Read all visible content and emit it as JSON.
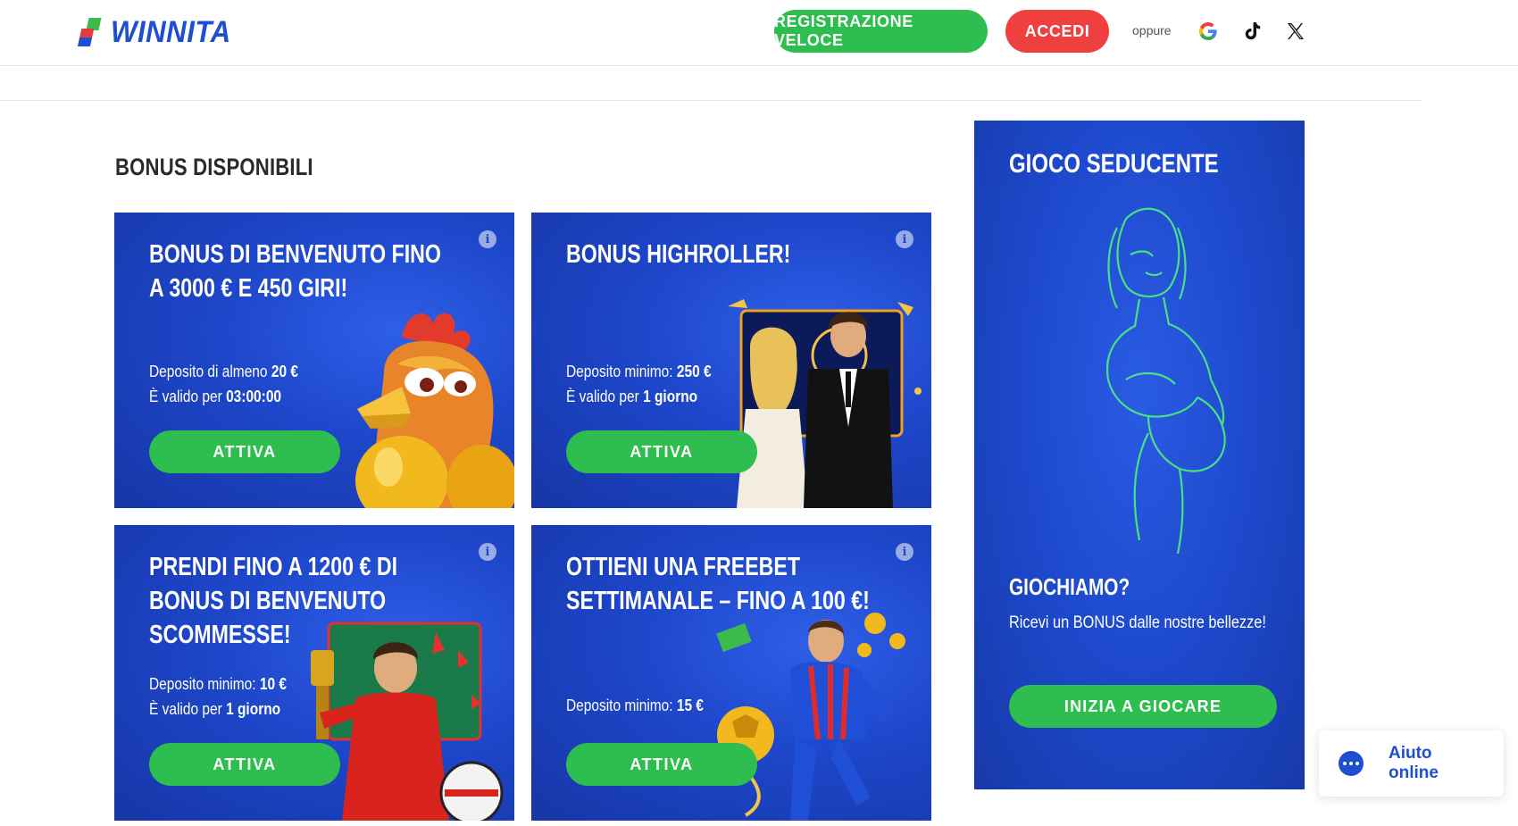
{
  "header": {
    "logo_text": "WINNITA",
    "register_label": "REGISTRAZIONE VELOCE",
    "login_label": "ACCEDI",
    "or_label": "oppure",
    "social_icons": [
      "google-icon",
      "tiktok-icon",
      "x-icon"
    ]
  },
  "colors": {
    "brand_blue": "#1e4fd1",
    "green_button": "#2ebd4f",
    "red_button": "#ef3f3f",
    "card_blue": "#1d46c9"
  },
  "bonuses": {
    "section_title": "BONUS DISPONIBILI",
    "cards": [
      {
        "title": "BONUS DI BENVENUTO FINO A 3000 € E 450 GIRI!",
        "line1_label": "Deposito di almeno",
        "line1_value": "20 €",
        "line2_label": "È valido per",
        "line2_value": "03:00:00",
        "button": "ATTIVA"
      },
      {
        "title": "BONUS HIGHROLLER!",
        "line1_label": "Deposito minimo:",
        "line1_value": "250 €",
        "line2_label": "È valido per",
        "line2_value": "1 giorno",
        "button": "ATTIVA"
      },
      {
        "title": "PRENDI FINO A 1200 € DI BONUS DI BENVENUTO SCOMMESSE!",
        "line1_label": "Deposito minimo:",
        "line1_value": "10 €",
        "line2_label": "È valido per",
        "line2_value": "1 giorno",
        "button": "ATTIVA"
      },
      {
        "title": "OTTIENI UNA FREEBET SETTIMANALE – FINO A 100 €!",
        "line1_label": "Deposito minimo:",
        "line1_value": "15 €",
        "button": "ATTIVA"
      }
    ]
  },
  "promo": {
    "title": "GIOCO SEDUCENTE",
    "subtitle": "GIOCHIAMO?",
    "description": "Ricevi un BONUS dalle nostre bellezze!",
    "button": "INIZIA A GIOCARE"
  },
  "chat": {
    "label": "Aiuto online"
  }
}
